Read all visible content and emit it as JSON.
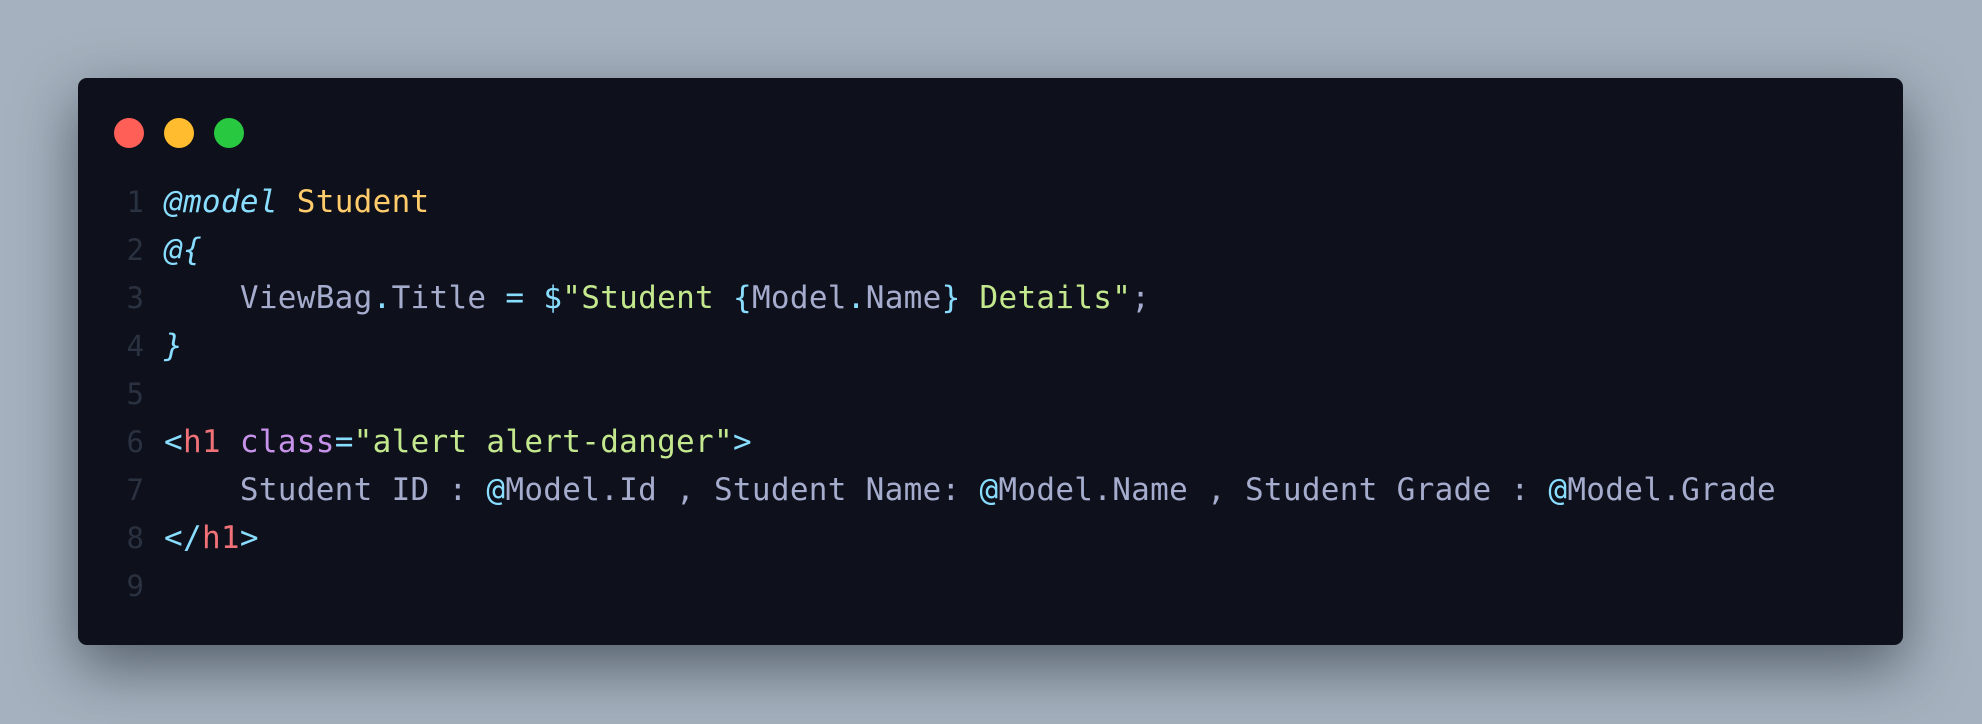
{
  "window": {
    "controls": [
      {
        "name": "close",
        "color": "#ff5f57"
      },
      {
        "name": "minimize",
        "color": "#febc2e"
      },
      {
        "name": "maximize",
        "color": "#28c840"
      }
    ]
  },
  "code": {
    "lines": [
      {
        "number": "1",
        "tokens": [
          {
            "text": "@model",
            "cls": "kw-model"
          },
          {
            "text": " ",
            "cls": "plain"
          },
          {
            "text": "Student",
            "cls": "type"
          }
        ]
      },
      {
        "number": "2",
        "tokens": [
          {
            "text": "@{",
            "cls": "punct-it"
          }
        ]
      },
      {
        "number": "3",
        "tokens": [
          {
            "text": "    ",
            "cls": "plain"
          },
          {
            "text": "ViewBag",
            "cls": "ident"
          },
          {
            "text": ".",
            "cls": "dotop"
          },
          {
            "text": "Title",
            "cls": "ident"
          },
          {
            "text": " ",
            "cls": "plain"
          },
          {
            "text": "=",
            "cls": "op"
          },
          {
            "text": " ",
            "cls": "plain"
          },
          {
            "text": "$",
            "cls": "op"
          },
          {
            "text": "\"Student ",
            "cls": "str"
          },
          {
            "text": "{",
            "cls": "brace"
          },
          {
            "text": "Model",
            "cls": "interp"
          },
          {
            "text": ".",
            "cls": "dotop"
          },
          {
            "text": "Name",
            "cls": "interp"
          },
          {
            "text": "}",
            "cls": "brace"
          },
          {
            "text": " Details\"",
            "cls": "str"
          },
          {
            "text": ";",
            "cls": "plain"
          }
        ]
      },
      {
        "number": "4",
        "tokens": [
          {
            "text": "}",
            "cls": "punct-it"
          }
        ]
      },
      {
        "number": "5",
        "tokens": []
      },
      {
        "number": "6",
        "tokens": [
          {
            "text": "<",
            "cls": "op"
          },
          {
            "text": "h1",
            "cls": "tag"
          },
          {
            "text": " ",
            "cls": "plain"
          },
          {
            "text": "class",
            "cls": "attr"
          },
          {
            "text": "=",
            "cls": "op"
          },
          {
            "text": "\"alert alert-danger\"",
            "cls": "str"
          },
          {
            "text": ">",
            "cls": "op"
          }
        ]
      },
      {
        "number": "7",
        "tokens": [
          {
            "text": "    Student ID : ",
            "cls": "plain"
          },
          {
            "text": "@",
            "cls": "at"
          },
          {
            "text": "Model.Id , Student Name: ",
            "cls": "plain"
          },
          {
            "text": "@",
            "cls": "at"
          },
          {
            "text": "Model.Name , Student Grade : ",
            "cls": "plain"
          },
          {
            "text": "@",
            "cls": "at"
          },
          {
            "text": "Model.Grade",
            "cls": "plain"
          }
        ]
      },
      {
        "number": "8",
        "tokens": [
          {
            "text": "</",
            "cls": "op"
          },
          {
            "text": "h1",
            "cls": "tag"
          },
          {
            "text": ">",
            "cls": "op"
          }
        ]
      },
      {
        "number": "9",
        "tokens": []
      }
    ]
  }
}
